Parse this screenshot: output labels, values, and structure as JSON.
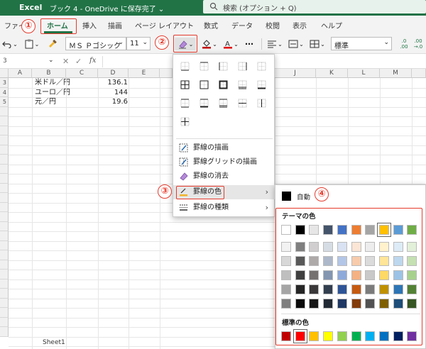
{
  "titlebar": {
    "app_name": "Excel",
    "doc_title": "ブック 4 - OneDrive に保存完了 ⌄",
    "search_placeholder": "検索 (オプション + Q)"
  },
  "tabs": [
    {
      "label": "ファイル"
    },
    {
      "label": "ホーム",
      "active": true
    },
    {
      "label": "挿入"
    },
    {
      "label": "描画"
    },
    {
      "label": "ページ レイアウト"
    },
    {
      "label": "数式"
    },
    {
      "label": "データ"
    },
    {
      "label": "校閲"
    },
    {
      "label": "表示"
    },
    {
      "label": "ヘルプ"
    }
  ],
  "ribbon": {
    "font_name": "ＭＳ Ｐゴシック",
    "font_size": "11",
    "bold": "B",
    "more": "⋯",
    "number_format": "標準",
    "inc_decimal": ".0\n.00",
    "dec_decimal": ".00\n→.0"
  },
  "formula_bar": {
    "name_box": "3",
    "fx": "fx"
  },
  "sheet": {
    "columns": [
      "A",
      "B",
      "C",
      "D",
      "E",
      "J",
      "K",
      "L",
      "M"
    ],
    "rows": [
      "3",
      "4",
      "5"
    ],
    "cells": [
      {
        "b": "米ドル／円",
        "d": "136.1"
      },
      {
        "b": "ユーロ／円",
        "d": "144"
      },
      {
        "b": "元／円",
        "d": "19.6"
      }
    ],
    "bottom_tab": "Sheet1"
  },
  "border_menu": {
    "items": [
      {
        "label": "罫線の描画"
      },
      {
        "label": "罫線グリッドの描画"
      },
      {
        "label": "罫線の消去"
      },
      {
        "label": "罫線の色",
        "submenu": true
      },
      {
        "label": "罫線の種類",
        "submenu": true
      }
    ]
  },
  "color_palette": {
    "auto_label": "自動",
    "theme_label": "テーマの色",
    "standard_label": "標準の色",
    "theme_top_row": [
      "#FFFFFF",
      "#000000",
      "#E7E6E6",
      "#44546A",
      "#4472C4",
      "#ED7D31",
      "#A5A5A5",
      "#FFC000",
      "#5B9BD5",
      "#70AD47"
    ],
    "theme_shades": [
      [
        "#F2F2F2",
        "#7F7F7F",
        "#D0CECE",
        "#D6DCE4",
        "#D9E2F3",
        "#FBE5D5",
        "#EDEDED",
        "#FFF2CC",
        "#DDEBF7",
        "#E2EFD9"
      ],
      [
        "#D8D8D8",
        "#595959",
        "#AEAAAA",
        "#ADB9CA",
        "#B4C6E7",
        "#F7CBAC",
        "#DBDBDB",
        "#FFE598",
        "#BDD7EE",
        "#C5E0B3"
      ],
      [
        "#BFBFBF",
        "#3F3F3F",
        "#757171",
        "#8496B0",
        "#8EAADB",
        "#F4B183",
        "#C9C9C9",
        "#FFD965",
        "#9CC3E5",
        "#A8D08D"
      ],
      [
        "#A5A5A5",
        "#262626",
        "#3A3838",
        "#323F4F",
        "#2F5496",
        "#C55A11",
        "#7B7B7B",
        "#BF9000",
        "#2E75B5",
        "#538135"
      ],
      [
        "#7F7F7F",
        "#0C0C0C",
        "#171616",
        "#222A35",
        "#1F3864",
        "#833C0B",
        "#525252",
        "#7F6000",
        "#1E4E79",
        "#375623"
      ]
    ],
    "standard_colors": [
      "#C00000",
      "#FF0000",
      "#FFC000",
      "#FFFF00",
      "#92D050",
      "#00B050",
      "#00B0F0",
      "#0070C0",
      "#002060",
      "#7030A0"
    ]
  },
  "annotations": {
    "step1": "①",
    "step2": "②",
    "step3": "③",
    "step4": "④"
  }
}
